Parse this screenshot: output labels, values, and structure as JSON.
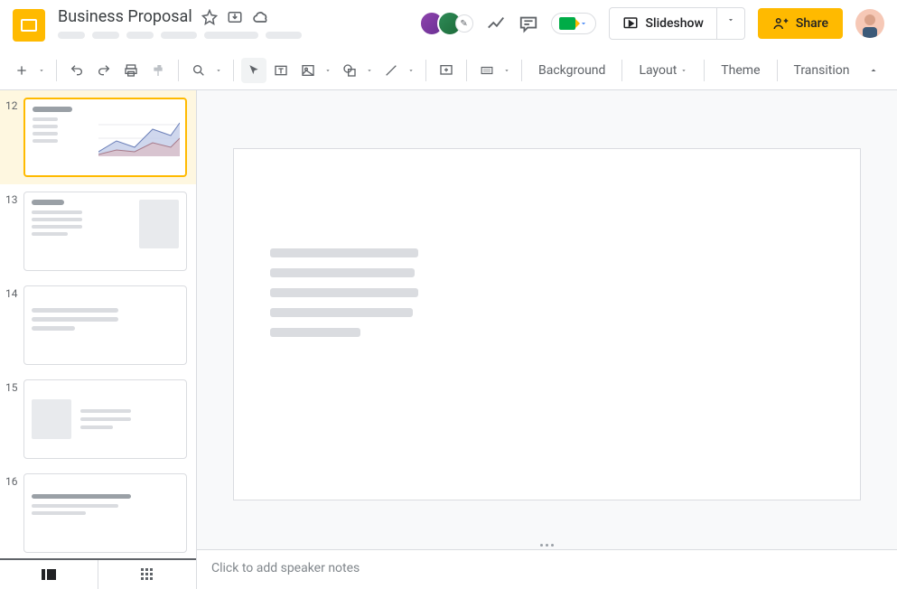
{
  "doc": {
    "title": "Business Proposal"
  },
  "header": {
    "slideshow_label": "Slideshow",
    "share_label": "Share"
  },
  "toolbar": {
    "background": "Background",
    "layout": "Layout",
    "theme": "Theme",
    "transition": "Transition"
  },
  "thumbnails": [
    {
      "num": "12"
    },
    {
      "num": "13"
    },
    {
      "num": "14"
    },
    {
      "num": "15"
    },
    {
      "num": "16"
    }
  ],
  "notes": {
    "placeholder": "Click to add speaker notes"
  }
}
